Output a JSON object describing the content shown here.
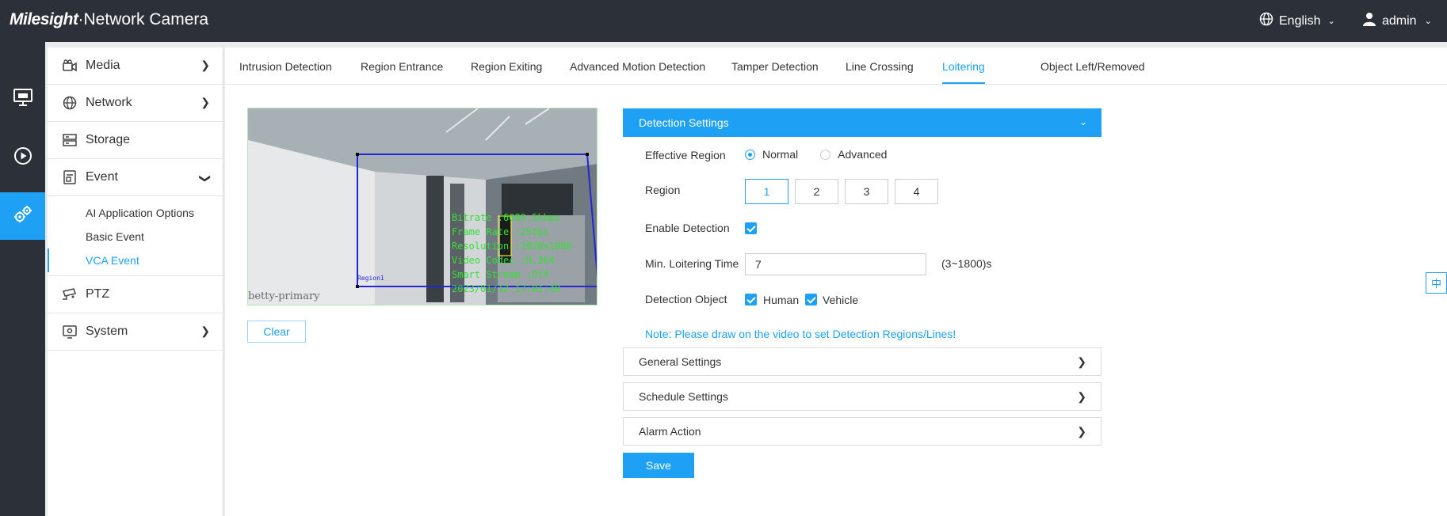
{
  "header": {
    "brand_logo": "Milesight",
    "brand_product": "·Network Camera",
    "language": "English",
    "user": "admin"
  },
  "rail": {
    "items": [
      {
        "icon": "live-view-monitor-icon"
      },
      {
        "icon": "playback-icon"
      },
      {
        "icon": "settings-gears-icon",
        "active": true
      }
    ]
  },
  "sidemenu": {
    "items": [
      {
        "label": "Media",
        "icon": "camera-icon"
      },
      {
        "label": "Network",
        "icon": "globe-icon"
      },
      {
        "label": "Storage",
        "icon": "storage-icon"
      },
      {
        "label": "Event",
        "icon": "event-icon",
        "expanded": true
      },
      {
        "label": "PTZ",
        "icon": "ptz-camera-icon"
      },
      {
        "label": "System",
        "icon": "system-gear-icon"
      }
    ],
    "event_sub": [
      {
        "label": "AI Application Options"
      },
      {
        "label": "Basic Event"
      },
      {
        "label": "VCA Event",
        "active": true
      }
    ]
  },
  "tabs": [
    {
      "label": "Intrusion Detection"
    },
    {
      "label": "Region Entrance"
    },
    {
      "label": "Region Exiting"
    },
    {
      "label": "Advanced Motion Detection"
    },
    {
      "label": "Tamper Detection"
    },
    {
      "label": "Line Crossing"
    },
    {
      "label": "Loitering",
      "active": true
    },
    {
      "label": "Object Left/Removed"
    }
  ],
  "video": {
    "osd_lines": [
      "Bitrate :6089.5kbps",
      "Frame Rate :25fps",
      "Resolution :1920x1080",
      "Video Codec :H.264",
      "Smart Stream :Off",
      "2023/01/12 17:01:49"
    ],
    "camera_name": "betty-primary",
    "region_tag": "Region1",
    "clear_label": "Clear"
  },
  "detection": {
    "title": "Detection Settings",
    "effective_region_label": "Effective Region",
    "effective_region_options": [
      "Normal",
      "Advanced"
    ],
    "effective_region_selected": "Normal",
    "region_label": "Region",
    "regions": [
      "1",
      "2",
      "3",
      "4"
    ],
    "region_selected": "1",
    "enable_label": "Enable Detection",
    "enable_checked": true,
    "min_time_label": "Min. Loitering Time",
    "min_time_value": "7",
    "min_time_range": "(3~1800)s",
    "object_label": "Detection Object",
    "objects": [
      "Human",
      "Vehicle"
    ],
    "note": "Note: Please draw on the video to set Detection Regions/Lines!"
  },
  "sections": [
    {
      "label": "General Settings"
    },
    {
      "label": "Schedule Settings"
    },
    {
      "label": "Alarm Action"
    }
  ],
  "save_label": "Save",
  "lang_switch": "中",
  "colors": {
    "accent": "#1ea0f5",
    "topbar": "#2b3039",
    "osd_text": "#35e035",
    "region_outline": "#2424d8"
  }
}
